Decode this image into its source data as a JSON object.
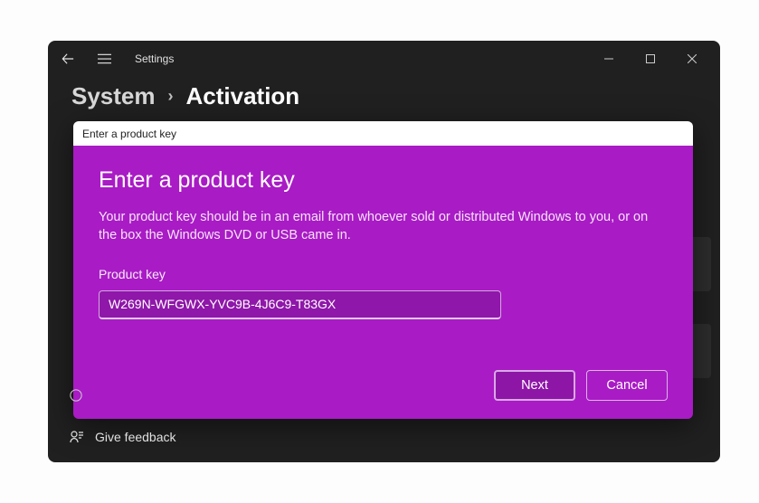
{
  "app": {
    "title": "Settings"
  },
  "breadcrumb": {
    "root": "System",
    "current": "Activation"
  },
  "dialog": {
    "caption": "Enter a product key",
    "title": "Enter a product key",
    "description": "Your product key should be in an email from whoever sold or distributed Windows to you, or on the box the Windows DVD or USB came in.",
    "field_label": "Product key",
    "product_key_value": "W269N-WFGWX-YVC9B-4J6C9-T83GX",
    "next_label": "Next",
    "cancel_label": "Cancel"
  },
  "footer": {
    "feedback_label": "Give feedback"
  },
  "colors": {
    "accent": "#a91bc5",
    "window_bg": "#202020"
  }
}
